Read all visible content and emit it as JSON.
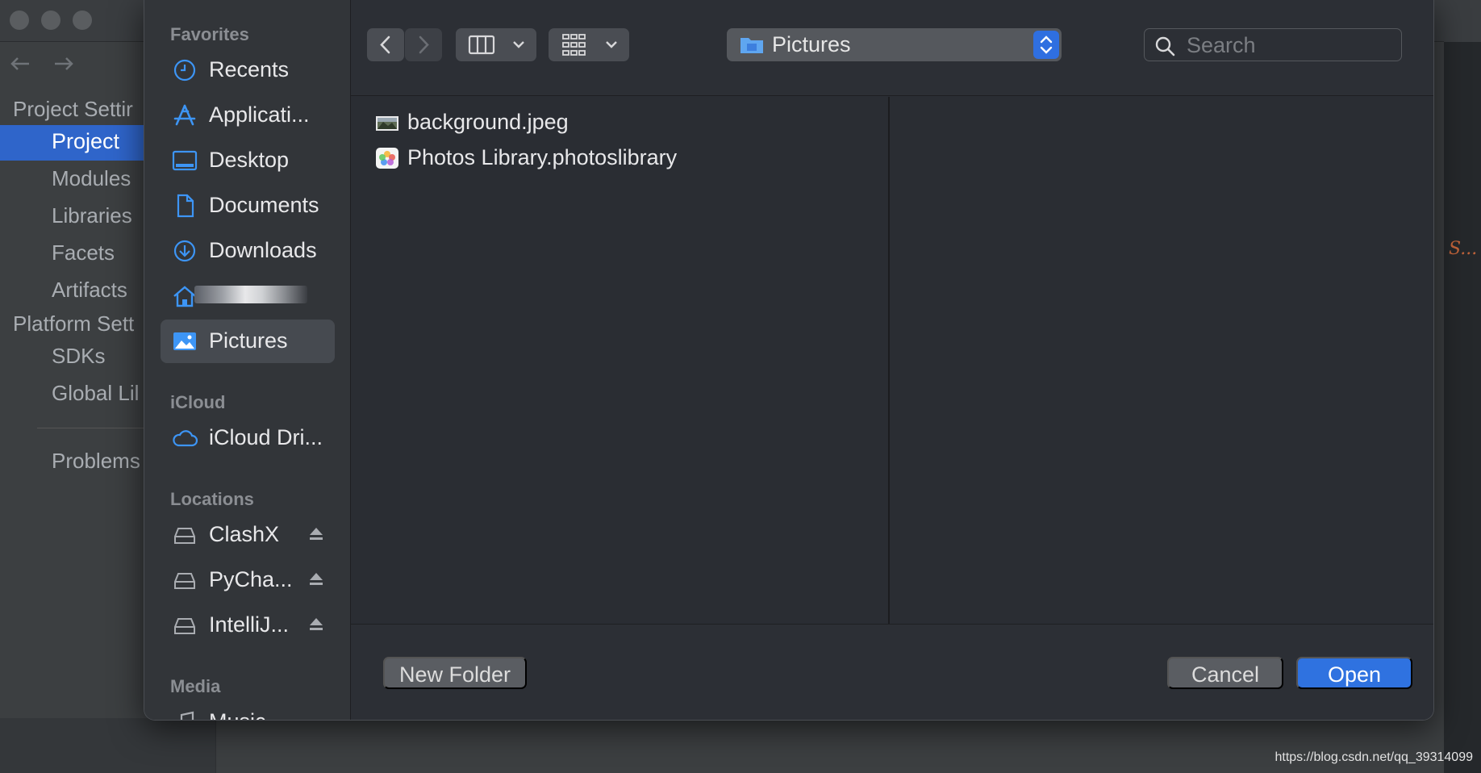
{
  "ide": {
    "sidebar": {
      "section_project": "Project Settir",
      "selected_item": "Project",
      "items": [
        "Modules",
        "Libraries",
        "Facets",
        "Artifacts"
      ],
      "section_platform": "Platform Sett",
      "platform_items": [
        "SDKs",
        "Global Lil"
      ],
      "problems": "Problems"
    },
    "right_mark": "S..."
  },
  "dialog": {
    "sidebar": {
      "favorites_label": "Favorites",
      "favorites": [
        {
          "label": "Recents",
          "icon": "clock-icon"
        },
        {
          "label": "Applicati...",
          "icon": "applications-icon"
        },
        {
          "label": "Desktop",
          "icon": "desktop-icon"
        },
        {
          "label": "Documents",
          "icon": "document-icon"
        },
        {
          "label": "Downloads",
          "icon": "download-icon"
        },
        {
          "label": "",
          "icon": "home-icon"
        },
        {
          "label": "Pictures",
          "icon": "pictures-icon",
          "selected": true
        }
      ],
      "icloud_label": "iCloud",
      "icloud": [
        {
          "label": "iCloud Dri...",
          "icon": "cloud-icon"
        }
      ],
      "locations_label": "Locations",
      "locations": [
        {
          "label": "ClashX",
          "icon": "drive-icon"
        },
        {
          "label": "PyCha...",
          "icon": "drive-icon"
        },
        {
          "label": "IntelliJ...",
          "icon": "drive-icon"
        }
      ],
      "media_label": "Media",
      "media": [
        {
          "label": "Music",
          "icon": "music-icon"
        }
      ]
    },
    "toolbar": {
      "current_folder": "Pictures",
      "search_placeholder": "Search"
    },
    "files": [
      {
        "name": "background.jpeg",
        "icon": "image-file-icon"
      },
      {
        "name": "Photos Library.photoslibrary",
        "icon": "photos-library-icon"
      }
    ],
    "buttons": {
      "new_folder": "New Folder",
      "cancel": "Cancel",
      "open": "Open"
    },
    "colors": {
      "accent": "#2f72e0",
      "icon_blue": "#3d95f5",
      "selection": "#464a50"
    }
  },
  "footer_url": "https://blog.csdn.net/qq_39314099"
}
